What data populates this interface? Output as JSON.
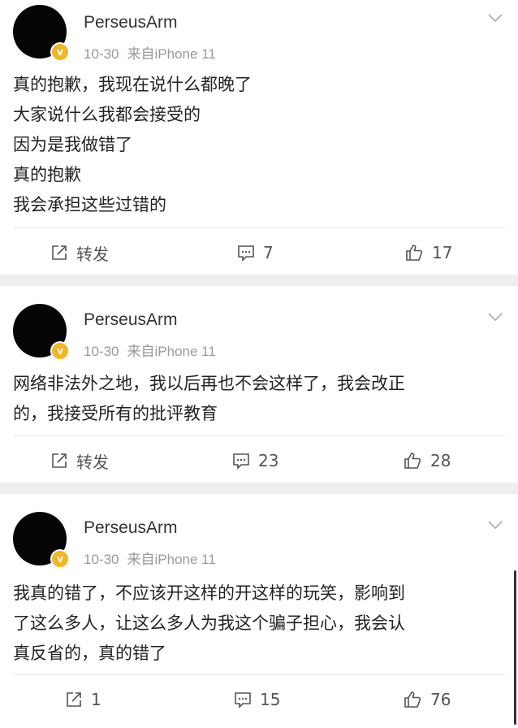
{
  "posts": [
    {
      "username": "PerseusArm",
      "date": "10-30",
      "source": "来自iPhone 11",
      "content_lines": [
        "真的抱歉，我现在说什么都晚了",
        "大家说什么我都会接受的",
        "因为是我做错了",
        "真的抱歉",
        "我会承担这些过错的"
      ],
      "repost": "转发",
      "comments": "7",
      "likes": "17"
    },
    {
      "username": "PerseusArm",
      "date": "10-30",
      "source": "来自iPhone 11",
      "content_lines": [
        "网络非法外之地，我以后再也不会这样了，我会改正",
        "的，我接受所有的批评教育"
      ],
      "repost": "转发",
      "comments": "23",
      "likes": "28"
    },
    {
      "username": "PerseusArm",
      "date": "10-30",
      "source": "来自iPhone 11",
      "content_lines": [
        "我真的错了，不应该开这样的开这样的玩笑，影响到",
        "了这么多人，让这么多人为我这个骗子担心，我会认",
        "真反省的，真的错了"
      ],
      "repost": "1",
      "comments": "15",
      "likes": "76"
    }
  ],
  "colors": {
    "badge": "#f0b62a",
    "meta": "#999999",
    "separator": "#eeeeee"
  },
  "icons": {
    "repost": "share-square-icon",
    "comment": "comment-bubble-icon",
    "like": "thumbs-up-icon",
    "more": "chevron-down-icon",
    "verified": "verified-v-badge-icon"
  }
}
